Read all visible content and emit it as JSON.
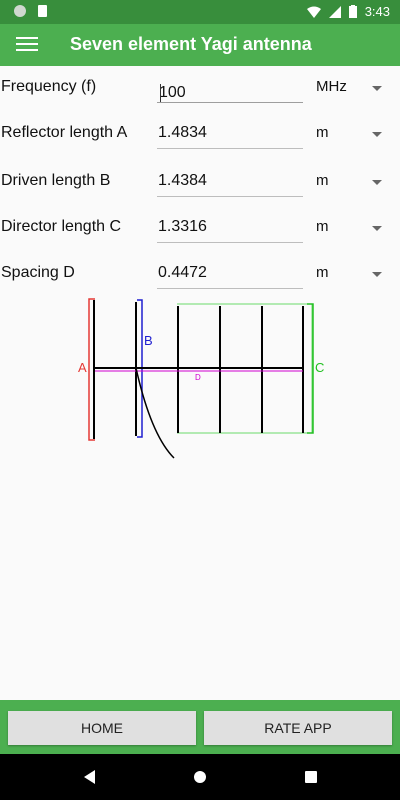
{
  "status_bar": {
    "time": "3:43"
  },
  "app_bar": {
    "title": "Seven element Yagi antenna"
  },
  "fields": [
    {
      "label": "Frequency (f)",
      "value": "100",
      "unit": "MHz"
    },
    {
      "label": "Reflector length A",
      "value": "1.4834",
      "unit": "m"
    },
    {
      "label": "Driven length B",
      "value": "1.4384",
      "unit": "m"
    },
    {
      "label": "Director length C",
      "value": "1.3316",
      "unit": "m"
    },
    {
      "label": "Spacing D",
      "value": "0.4472",
      "unit": "m"
    }
  ],
  "diagram": {
    "label_a": "A",
    "label_b": "B",
    "label_c": "C",
    "label_d": "D",
    "colors": {
      "a": "#e53935",
      "b": "#1e1ecf",
      "c": "#22c022",
      "d": "#d000d0",
      "boom": "#000000"
    }
  },
  "buttons": {
    "home": "HOME",
    "rate": "RATE APP"
  }
}
